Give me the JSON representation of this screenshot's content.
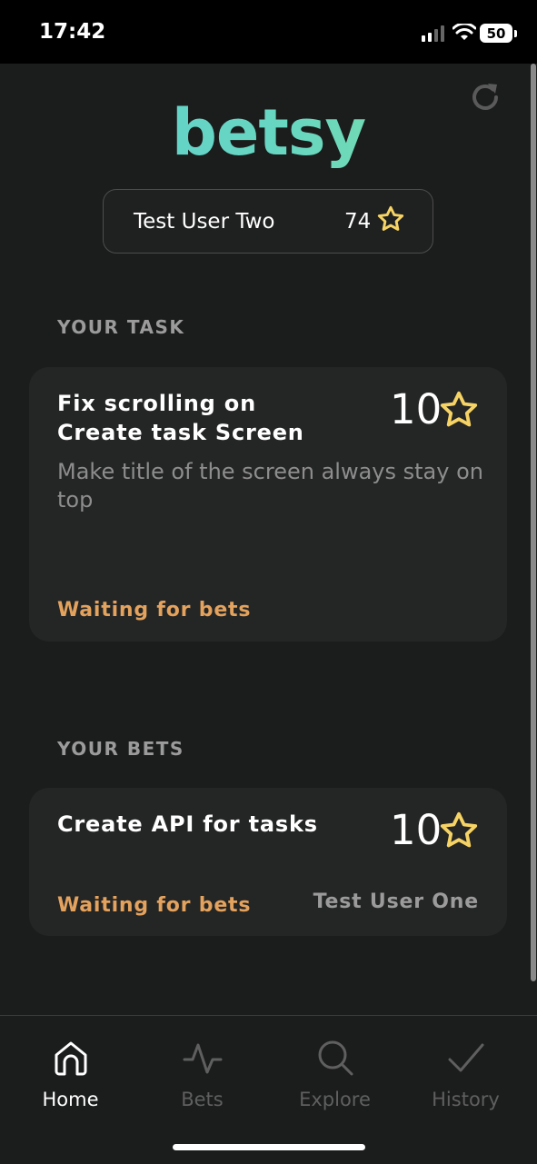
{
  "status_bar": {
    "time": "17:42",
    "battery": "50"
  },
  "app": {
    "logo": "betsy"
  },
  "user": {
    "name": "Test User Two",
    "points": "74"
  },
  "your_task": {
    "section_title": "YOUR TASK",
    "title": "Fix scrolling on Create task Screen",
    "points": "10",
    "description": "Make title of the screen always stay on top",
    "status": "Waiting for bets"
  },
  "your_bets": {
    "section_title": "YOUR BETS",
    "title": "Create API for tasks",
    "points": "10",
    "status": "Waiting for bets",
    "user": "Test User One"
  },
  "nav": {
    "items": [
      {
        "label": "Home",
        "icon": "home-icon",
        "active": true
      },
      {
        "label": "Bets",
        "icon": "activity-icon",
        "active": false
      },
      {
        "label": "Explore",
        "icon": "search-icon",
        "active": false
      },
      {
        "label": "History",
        "icon": "check-icon",
        "active": false
      }
    ]
  },
  "colors": {
    "accent_star": "#f6d365",
    "status_orange": "#e3a25d",
    "logo_gradient_start": "#5ecfd1",
    "logo_gradient_end": "#86e09a"
  }
}
